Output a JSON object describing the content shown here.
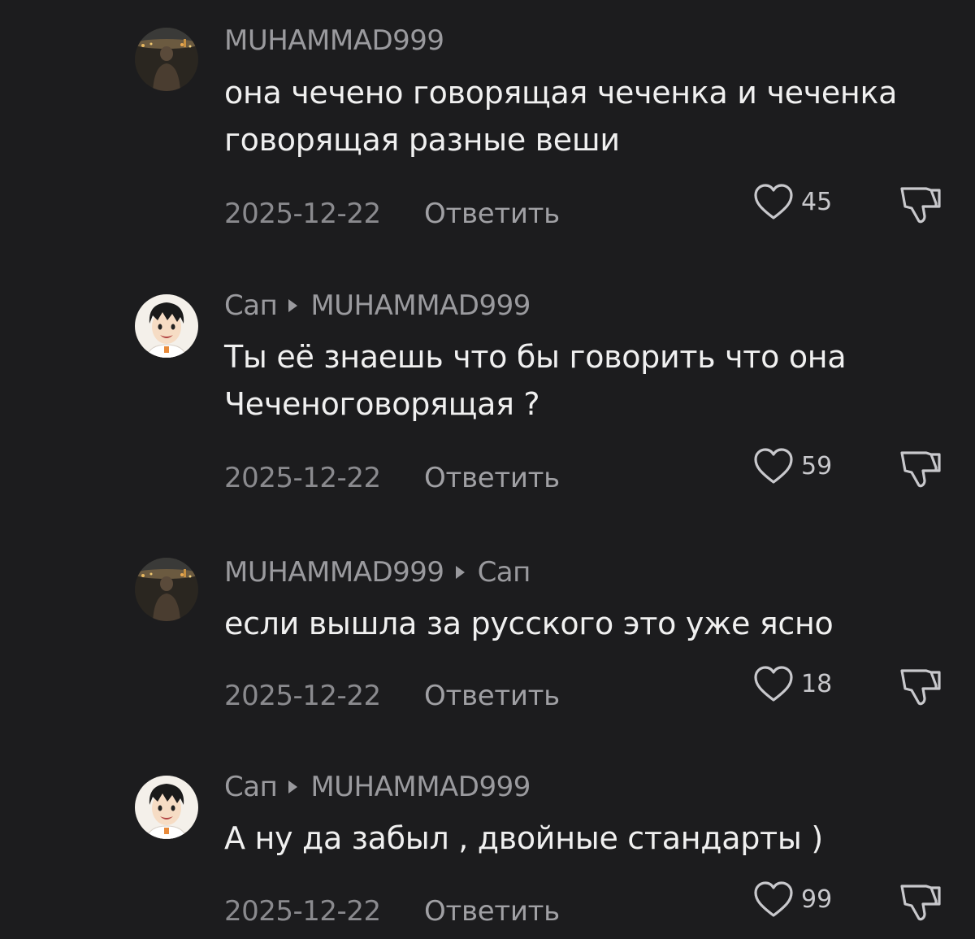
{
  "comments": [
    {
      "author": "MUHAMMAD999",
      "reply_to": "",
      "text": "она чечено говорящая чеченка и чеченка говорящая разные веши",
      "date": "2025-12-22",
      "reply_label": "Ответить",
      "likes": "45",
      "avatar": "night-city-avatar"
    },
    {
      "author": "Сап",
      "reply_to": "MUHAMMAD999",
      "text": "Ты её знаешь что бы говорить что она Чеченоговорящая ?",
      "date": "2025-12-22",
      "reply_label": "Ответить",
      "likes": "59",
      "avatar": "anime-boy-avatar"
    },
    {
      "author": "MUHAMMAD999",
      "reply_to": "Сап",
      "text": "если вышла за русского это уже ясно",
      "date": "2025-12-22",
      "reply_label": "Ответить",
      "likes": "18",
      "avatar": "night-city-avatar"
    },
    {
      "author": "Сап",
      "reply_to": "MUHAMMAD999",
      "text": "А ну да забыл , двойные стандарты )",
      "date": "2025-12-22",
      "reply_label": "Ответить",
      "likes": "99",
      "avatar": "anime-boy-avatar"
    }
  ],
  "icons": {
    "like": "heart-outline-icon",
    "dislike": "thumbs-down-outline-icon",
    "reply_arrow": "triangle-right-icon"
  },
  "colors": {
    "background": "#1c1c1e",
    "text": "#f0f0f0",
    "muted": "#9a9a9e"
  }
}
